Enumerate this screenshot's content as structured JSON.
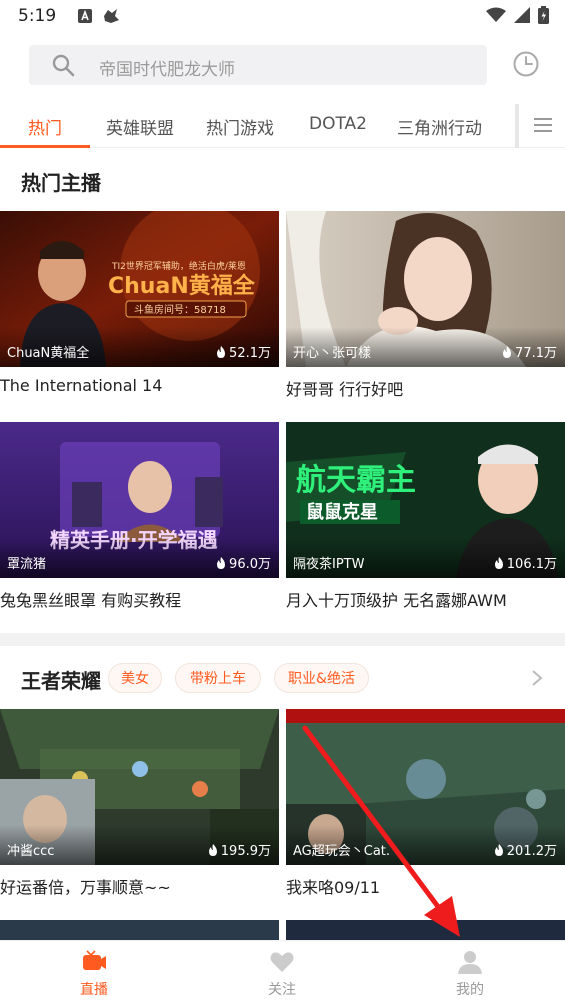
{
  "status_bar": {
    "time": "5:19"
  },
  "search": {
    "placeholder": "帝国时代肥龙大师"
  },
  "tabs": [
    {
      "label": "热门",
      "active": true
    },
    {
      "label": "英雄联盟"
    },
    {
      "label": "热门游戏"
    },
    {
      "label": "DOTA2"
    },
    {
      "label": "三角洲行动"
    }
  ],
  "hot_section": {
    "title": "热门主播",
    "cards": [
      {
        "anchor": "ChuaN黄福全",
        "viewers": "52.1万",
        "title": "The International 14"
      },
      {
        "anchor": "开心丶张可樣",
        "viewers": "77.1万",
        "title": "好哥哥 行行好吧"
      },
      {
        "anchor": "罩流猪",
        "viewers": "96.0万",
        "title": "兔兔黑丝眼罩 有购买教程"
      },
      {
        "anchor": "隔夜茶IPTW",
        "viewers": "106.1万",
        "title": "月入十万顶级护 无名露娜AWM"
      }
    ]
  },
  "thumb_text": {
    "chuan_banner": "ChuaN黄福全",
    "chuan_sub": "TI2世界冠军辅助，绝活白虎/莱恩",
    "chuan_room": "斗鱼房间号：58718",
    "purple_banner": "精英手册·开学福遇",
    "green_banner": "航天霸主",
    "green_sub": "鼠鼠克星"
  },
  "glory_section": {
    "title": "王者荣耀",
    "chips": [
      "美女",
      "带粉上车",
      "职业&绝活"
    ],
    "cards": [
      {
        "anchor": "冲酱ccc",
        "viewers": "195.9万",
        "title": "好运番倍，万事顺意~~"
      },
      {
        "anchor": "AG超玩会丶Cat.",
        "viewers": "201.2万",
        "title": "我来咯09/11"
      }
    ]
  },
  "bottom_nav": [
    {
      "label": "直播",
      "active": true
    },
    {
      "label": "关注"
    },
    {
      "label": "我的"
    }
  ],
  "colors": {
    "accent": "#ff5a1f",
    "annotation_arrow": "#ee1c1c"
  },
  "icons": [
    "search-icon",
    "history-icon",
    "menu-icon",
    "fire-icon",
    "chevron-right-icon",
    "live-tv-icon",
    "heart-icon",
    "person-icon",
    "wifi-icon",
    "signal-icon",
    "battery-icon"
  ]
}
